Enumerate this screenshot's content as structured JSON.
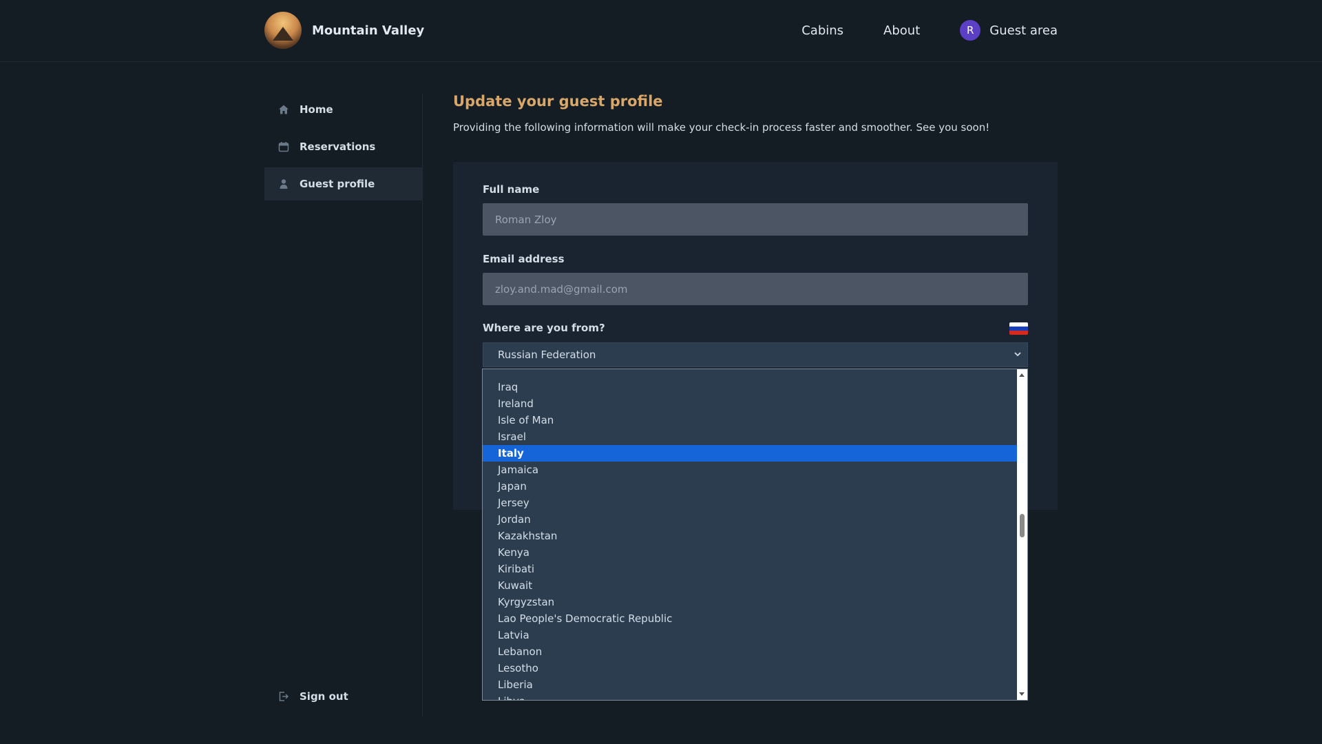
{
  "header": {
    "brand": "Mountain Valley",
    "nav": {
      "cabins": "Cabins",
      "about": "About",
      "guest_area": "Guest area",
      "avatar_initial": "R"
    }
  },
  "sidebar": {
    "items": [
      {
        "label": "Home",
        "icon": "home-icon"
      },
      {
        "label": "Reservations",
        "icon": "calendar-icon"
      },
      {
        "label": "Guest profile",
        "icon": "user-icon",
        "active": true
      }
    ],
    "sign_out": "Sign out"
  },
  "main": {
    "title": "Update your guest profile",
    "description": "Providing the following information will make your check-in process faster and smoother. See you soon!",
    "form": {
      "full_name_label": "Full name",
      "full_name_value": "Roman Zloy",
      "email_label": "Email address",
      "email_value": "zloy.and.mad@gmail.com",
      "country_label": "Where are you from?",
      "country_selected": "Russian Federation",
      "flag_colors": [
        "#ffffff",
        "#1c3fb8",
        "#d52b1e"
      ]
    }
  },
  "dropdown": {
    "options": [
      "Iraq",
      "Ireland",
      "Isle of Man",
      "Israel",
      "Italy",
      "Jamaica",
      "Japan",
      "Jersey",
      "Jordan",
      "Kazakhstan",
      "Kenya",
      "Kiribati",
      "Kuwait",
      "Kyrgyzstan",
      "Lao People's Democratic Republic",
      "Latvia",
      "Lebanon",
      "Lesotho",
      "Liberia",
      "Libya"
    ],
    "highlighted": "Italy"
  },
  "colors": {
    "accent": "#d8a769",
    "highlight": "#1565d8",
    "avatar": "#5b3fc4"
  }
}
